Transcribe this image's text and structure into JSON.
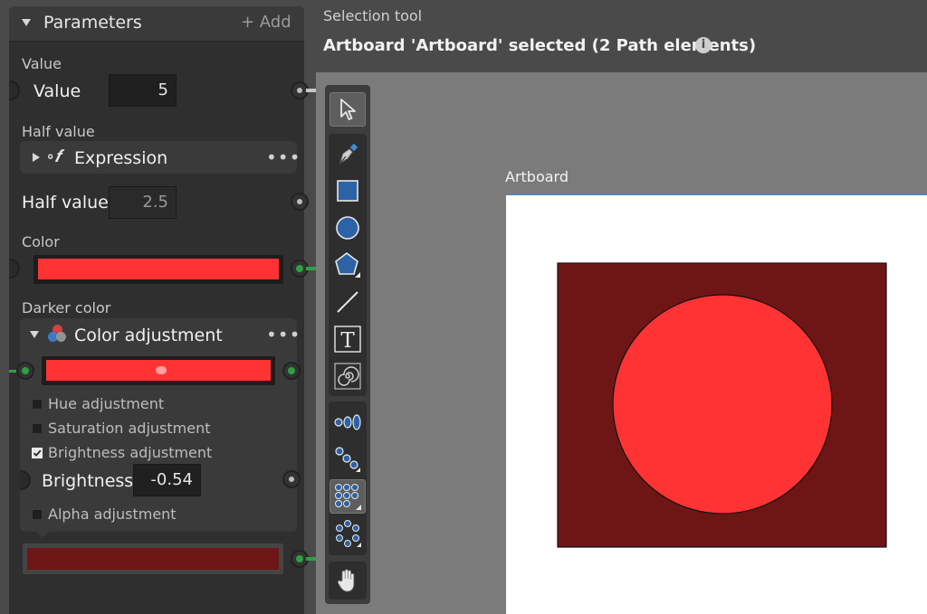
{
  "panel": {
    "title": "Parameters",
    "add_label": "+ Add",
    "value_section": {
      "section_label": "Value",
      "param_label": "Value",
      "value": "5"
    },
    "half_section": {
      "section_label": "Half value",
      "node_title": "Expression",
      "node_more": "•••",
      "param_label": "Half value",
      "value": "2.5"
    },
    "color_section": {
      "section_label": "Color",
      "color": "#ff3333"
    },
    "darker_section": {
      "section_label": "Darker color",
      "node_title": "Color adjustment",
      "node_more": "•••",
      "input_color": "#ff3333",
      "checks": [
        {
          "label": "Hue adjustment",
          "checked": false
        },
        {
          "label": "Saturation adjustment",
          "checked": false
        },
        {
          "label": "Brightness adjustment",
          "checked": true
        }
      ],
      "brightness_label": "Brightness",
      "brightness_value": "-0.54",
      "alpha_check": {
        "label": "Alpha adjustment",
        "checked": false
      },
      "output_color": "#6e1616"
    }
  },
  "header": {
    "tool_name": "Selection tool",
    "status": "Artboard 'Artboard' selected (2 Path elements)",
    "info_icon": "info-icon"
  },
  "canvas": {
    "artboard_label": "Artboard",
    "rect_fill": "#6e1616",
    "circle_fill": "#ff3333"
  },
  "toolbar": {
    "tools": [
      "selection-tool",
      "pen-tool",
      "rectangle-tool",
      "ellipse-tool",
      "polygon-tool",
      "line-tool",
      "text-tool",
      "spiral-tool",
      "align-tool",
      "distribute-tool",
      "grid-tool",
      "group-tool",
      "hand-tool"
    ]
  }
}
